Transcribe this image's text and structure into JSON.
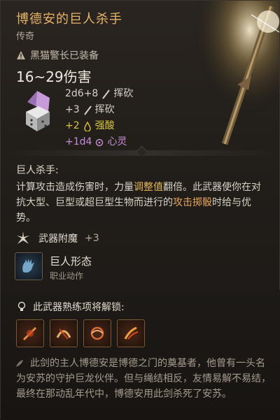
{
  "header": {
    "title": "博德安的巨人杀手",
    "rarity": "传奇",
    "equipped_by": "黑猫警长已装备",
    "damage_range": "16~29伤害"
  },
  "damage": [
    {
      "value": "2d6+8",
      "type": "挥砍",
      "color": "#d8d0c4",
      "icon": "slash-icon"
    },
    {
      "value": "+3",
      "type": "挥砍",
      "color": "#d8d0c4",
      "icon": "slash-icon"
    },
    {
      "value": "+2",
      "type": "强酸",
      "color": "#d9c441",
      "icon": "acid-icon"
    },
    {
      "value": "+1d4",
      "type": "心灵",
      "color": "#c48fd6",
      "icon": "psychic-icon"
    }
  ],
  "ability": {
    "title": "巨人杀手:",
    "desc_parts": [
      {
        "text": "计算攻击造成伤害时，力量",
        "style": "normal"
      },
      {
        "text": "调整值",
        "style": "yellow"
      },
      {
        "text": "翻倍。此武器使你在对抗大型、巨型或超巨型生物而进行的",
        "style": "normal"
      },
      {
        "text": "攻击掷骰",
        "style": "orange"
      },
      {
        "text": "时给与优势。",
        "style": "normal"
      }
    ]
  },
  "enchant": {
    "label": "武器附魔",
    "bonus": "+3"
  },
  "action": {
    "name": "巨人形态",
    "type": "职业动作"
  },
  "proficiency": {
    "label": "此武器熟练项将解锁:",
    "icons": [
      "sword-strike-icon",
      "slash-arc-icon",
      "whirl-icon",
      "flame-slash-icon"
    ]
  },
  "lore": "此剑的主人博德安是博德之门的奠基者，他曾有一头名为安苏的守护巨龙伙伴。但与绳结相反，友情易解不易结，最终在那动乱年代中，博德安用此剑杀死了安苏。",
  "colors": {
    "title": "#e7b36a",
    "acid": "#d9c441",
    "psychic": "#c48fd6"
  }
}
